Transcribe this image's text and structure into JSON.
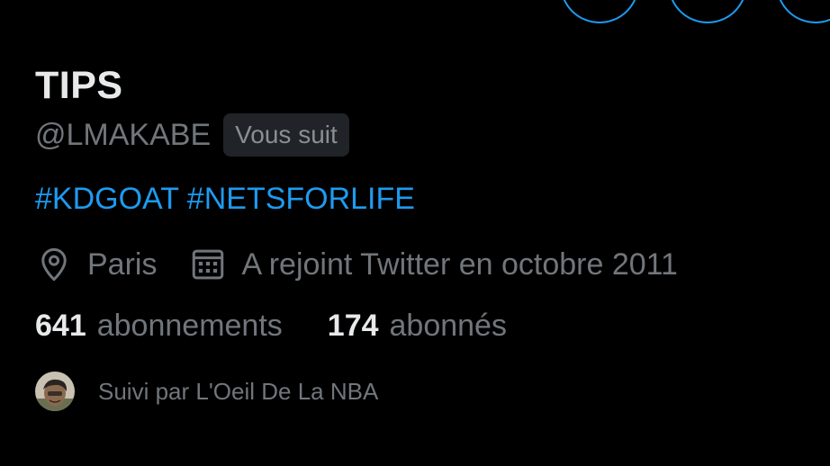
{
  "profile": {
    "display_name": "TIPS",
    "handle": "@LMAKABE",
    "follows_you_badge": "Vous suit",
    "bio_hashtags": [
      "#KDGOAT",
      "#NETSFORLIFE"
    ],
    "location": "Paris",
    "joined": "A rejoint Twitter en octobre 2011",
    "following_count": "641",
    "following_label": "abonnements",
    "followers_count": "174",
    "followers_label": "abonnés",
    "followed_by": "Suivi par L'Oeil De La NBA"
  },
  "icons": {
    "location": "location-pin-icon",
    "joined": "calendar-icon"
  },
  "colors": {
    "background": "#000000",
    "accent": "#1d9bf0",
    "primary_text": "#e7e9ea",
    "secondary_text": "#71767b",
    "badge_bg": "#202327"
  }
}
